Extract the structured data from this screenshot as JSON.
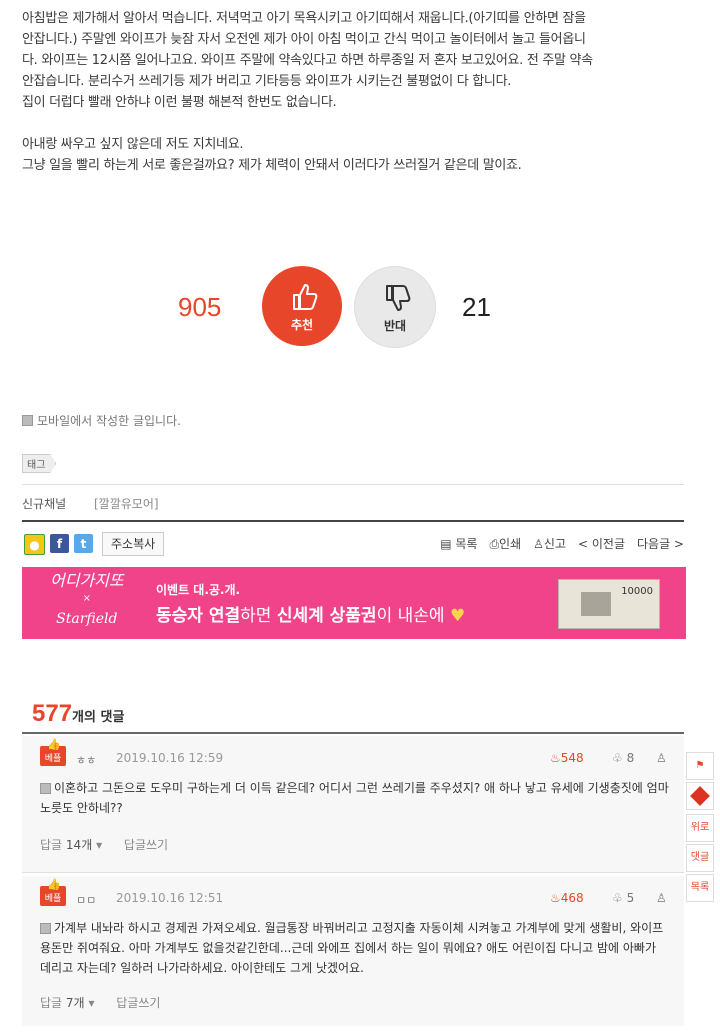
{
  "article": {
    "lines": [
      "아침밥은 제가해서 알아서 먹습니다. 저녁먹고 아기 목욕시키고 아기띠해서 재웁니다.(아기띠를 안하면 잠을",
      "안잡니다.) 주말엔 와이프가 늦잠 자서 오전엔 제가 아이 아침 먹이고 간식 먹이고 놀이터에서 놀고 들어옵니",
      "다. 와이프는 12시쯤 일어나고요. 와이프 주말에 약속있다고 하면 하루종일 저 혼자 보고있어요. 전 주말 약속",
      "안잡습니다. 분리수거 쓰레기등 제가 버리고 기타등등 와이프가 시키는건 불평없이 다 합니다.",
      "집이 더럽다 빨래 안하냐 이런 불평 해본적 한번도 없습니다.",
      "",
      "아내랑 싸우고 싶지 않은데 저도 지치네요.",
      "그냥 일을 빨리 하는게 서로 좋은걸까요? 제가 체력이 안돼서 이러다가 쓰러질거 같은데 말이죠."
    ]
  },
  "vote": {
    "up_count": "905",
    "up_label": "추천",
    "down_label": "반대",
    "down_count": "21"
  },
  "meta": {
    "mobile_note": "모바일에서 작성한 글입니다.",
    "tag_label": "태그",
    "channel": "신규채널",
    "category": "[깔깔유모어]"
  },
  "share": {
    "copy_label": "주소복사",
    "list_label": "목록",
    "print_label": "인쇄",
    "report_label": "신고",
    "prev_label": "< 이전글",
    "next_label": "다음글 >"
  },
  "banner": {
    "logo_top": "어디가지또",
    "logo_x": "×",
    "logo_brand": "Starfield",
    "event_label": "이벤트 대.공.개.",
    "main_part1": "동승자 연결",
    "main_part2": "하면 ",
    "main_part3": "신세계 상품권",
    "main_part4": "이 내손에 ",
    "heart": "♥",
    "bill_value": "10000"
  },
  "comments_header": {
    "count": "577",
    "suffix": "개의 댓글"
  },
  "comments": [
    {
      "badge": "베플",
      "nick": "ㅎㅎ",
      "date": "2019.10.16 12:59",
      "up": "548",
      "down": "8",
      "text": "이혼하고 그돈으로 도우미 구하는게 더 이득 같은데? 어디서 그런 쓰레기를 주우셨지? 애 하나 낳고 유세에 기생충짓에 엄마노릇도 안하네??",
      "reply_label": "답글",
      "reply_count": "14개",
      "write_label": "답글쓰기"
    },
    {
      "badge": "베플",
      "nick": "ㅁㅁ",
      "date": "2019.10.16 12:51",
      "up": "468",
      "down": "5",
      "text": "가계부 내놔라 하시고 경제권 가져오세요. 월급통장 바꿔버리고 고정지출 자동이체 시켜놓고 가계부에 맞게 생활비, 와이프 용돈만 쥐여줘요. 아마 가계부도 없을것같긴한데...근데 와에프 집에서 하는 일이 뭐에요? 애도 어린이집 다니고 밤에 아빠가 데리고 자는데? 일하러 나가라하세요. 아이한테도 그게 낫겠어요.",
      "reply_label": "답글",
      "reply_count": "7개",
      "write_label": "답글쓰기"
    }
  ],
  "side_nav": {
    "up_label": "위로",
    "comment_label": "댓글",
    "list_label": "목록"
  }
}
